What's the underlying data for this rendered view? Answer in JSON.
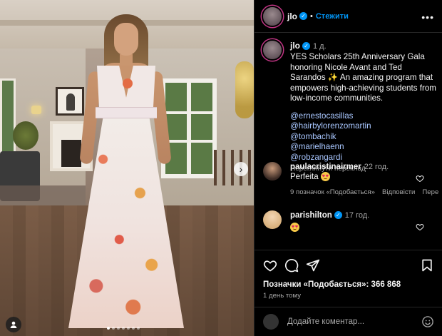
{
  "post_author": {
    "username": "jlo",
    "verified": true,
    "follow_label": "Стежити"
  },
  "caption": {
    "username": "jlo",
    "time": "1 д.",
    "text": "YES Scholars 25th Anniversary Gala honoring Nicole Avant and Ted Sarandos ✨ An amazing program that empowers high-achieving students from low-income communities.",
    "mentions": [
      "@ernestocasillas",
      "@hairbylorenzomartin",
      "@tombachik",
      "@marielhaenn",
      "@robzangardi"
    ],
    "see_translation": "Переглянути переклад"
  },
  "comments": [
    {
      "username": "paulacristinairmer",
      "time": "22 год.",
      "text": "Perfeita",
      "emoji": "heart-eyes",
      "likes_label": "9 позначок «Подобається»",
      "reply_label": "Відповісти",
      "more_label": "Пере"
    },
    {
      "username": "parishilton",
      "verified": true,
      "time": "17 год.",
      "text": "",
      "emoji": "heart-eyes"
    }
  ],
  "actions": {
    "likes": "Позначки «Подобається»: 366 868",
    "posted": "1 день тому"
  },
  "add_comment": {
    "placeholder": "Додайте коментар..."
  },
  "photo": {
    "carousel_count": 7,
    "active_index": 0
  },
  "colors": {
    "accent": "#0095f6",
    "background": "#000000",
    "secondary_text": "#a8a8a8"
  }
}
